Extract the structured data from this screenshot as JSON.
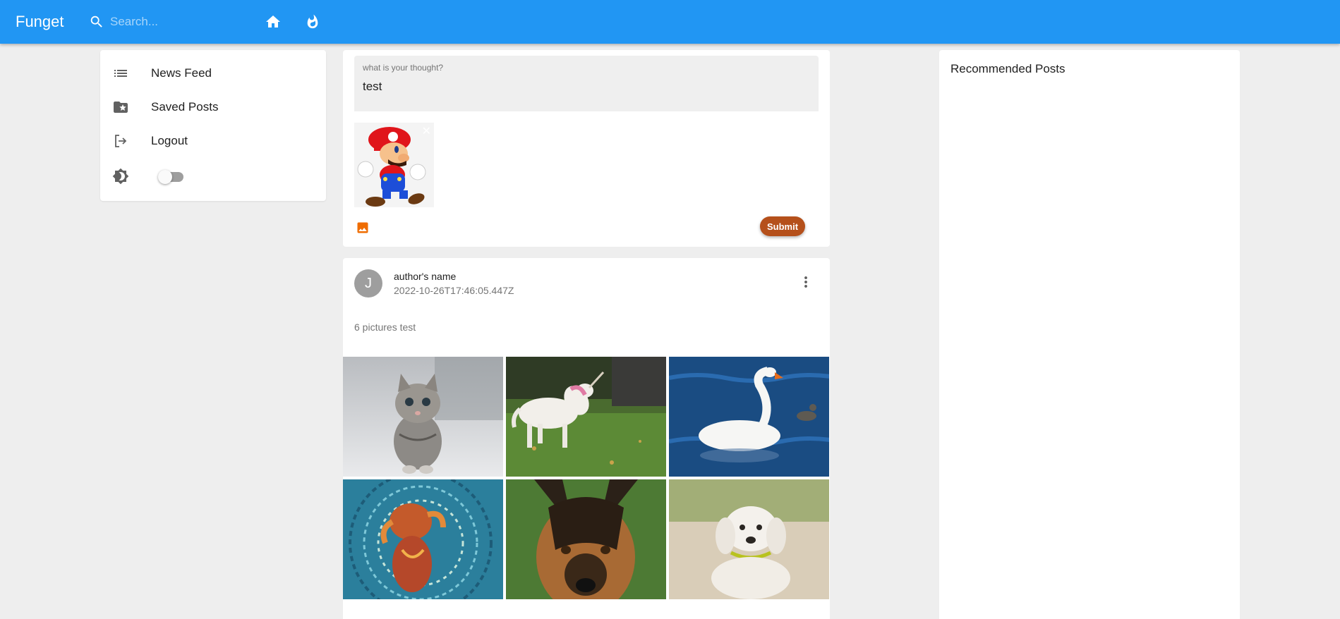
{
  "app": {
    "brand": "Funget"
  },
  "search": {
    "placeholder": "Search..."
  },
  "nav": {
    "home_icon": "home-icon",
    "trending_icon": "whatshot-icon"
  },
  "sidebar": {
    "items": [
      {
        "label": "News Feed",
        "icon": "list-icon"
      },
      {
        "label": "Saved Posts",
        "icon": "folder-special-icon"
      },
      {
        "label": "Logout",
        "icon": "logout-icon"
      }
    ],
    "theme_toggle": {
      "icon": "brightness-icon",
      "checked": false
    }
  },
  "composer": {
    "field_label": "what is your thought?",
    "field_value": "test",
    "preview_image": "mario-image",
    "submit_label": "Submit"
  },
  "post": {
    "avatar_letter": "J",
    "author": "author's name",
    "date": "2022-10-26T17:46:05.447Z",
    "text": "6 pictures test",
    "images": [
      "kitten",
      "unicorn",
      "swan",
      "painted-dog",
      "german-shepherd",
      "white-puppy"
    ]
  },
  "recommended": {
    "title": "Recommended Posts"
  },
  "colors": {
    "appbar": "#2196f3",
    "submit": "#b5501b",
    "image_icon": "#ef6c00"
  }
}
